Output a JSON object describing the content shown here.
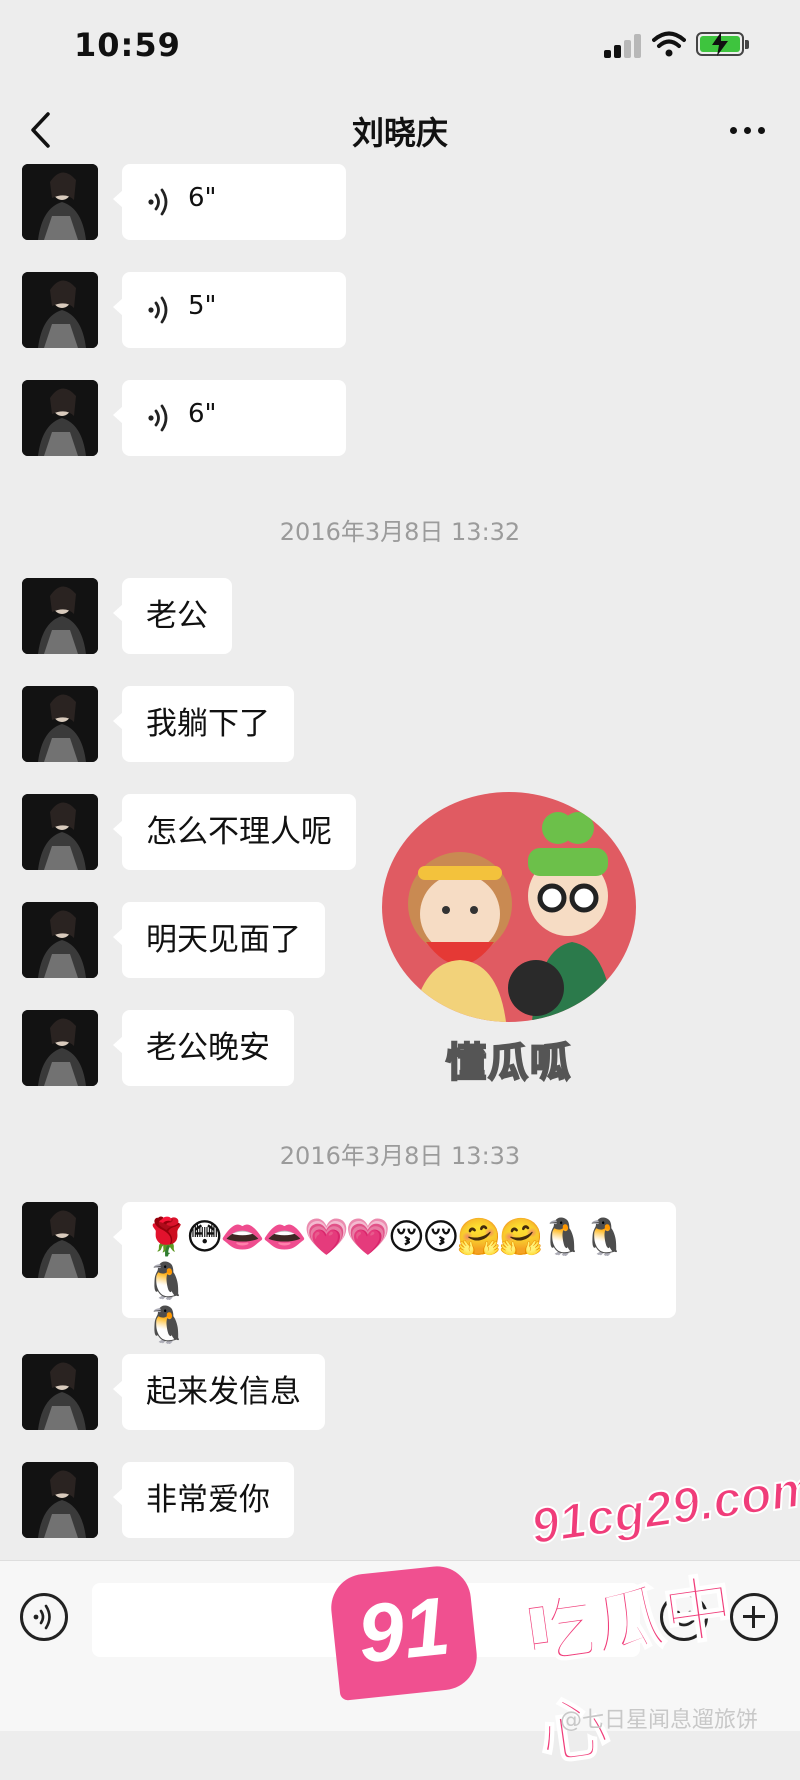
{
  "status_bar": {
    "time": "10:59"
  },
  "header": {
    "title": "刘晓庆"
  },
  "messages": {
    "voice": [
      {
        "duration": "6\""
      },
      {
        "duration": "5\""
      },
      {
        "duration": "6\""
      }
    ],
    "timestamp_1": "2016年3月8日 13:32",
    "text_1": [
      "老公",
      "我躺下了",
      "怎么不理人呢",
      "明天见面了",
      "老公晚安"
    ],
    "timestamp_2": "2016年3月8日 13:33",
    "emoji_line_1": "🌹😳👄👄💗💗😚😚🤗🤗🐧🐧🐧",
    "emoji_line_2": "🐧",
    "text_2": [
      "起来发信息",
      "非常爱你"
    ]
  },
  "overlay_watermark": {
    "caption": "懂瓜呱"
  },
  "site_watermark": {
    "logo": "91",
    "url": "91cg29.com",
    "name": "吃瓜中心",
    "credit": "@七日星闻息遛旅饼"
  },
  "input_bar": {
    "placeholder": ""
  },
  "colors": {
    "background": "#ededed",
    "bubble": "#ffffff",
    "timestamp": "#9b9b9b",
    "watermark_pink": "#f03d7a"
  },
  "icons": {
    "back": "chevron-left-icon",
    "more": "more-dots-icon",
    "voice": "voice-wave-icon",
    "emoji": "smiley-icon",
    "plus": "plus-circle-icon"
  }
}
